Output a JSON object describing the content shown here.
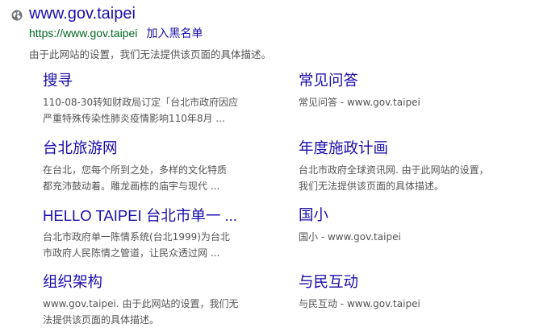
{
  "result": {
    "globe_icon": "globe-icon",
    "title": "www.gov.taipei",
    "url": "https://www.gov.taipei",
    "block_label": "加入黑名单",
    "snippet": "由于此网站的设置，我们无法提供该页面的具体描述。"
  },
  "sitelinks": [
    {
      "title": "搜寻",
      "snippet_line1": "110-08-30转知财政局订定「台北市政府因应",
      "snippet_line2": "严重特殊传染性肺炎疫情影响110年8月 ..."
    },
    {
      "title": "常见问答",
      "snippet_line1": "常见问答 - www.gov.taipei",
      "snippet_line2": ""
    },
    {
      "title": "台北旅游网",
      "snippet_line1": "在台北，您每个所到之处，多样的文化特质",
      "snippet_line2": "都充沛鼓动着。雕龙画栋的庙宇与现代 ..."
    },
    {
      "title": "年度施政计画",
      "snippet_line1": "台北市政府全球资讯网. 由于此网站的设置，",
      "snippet_line2": "我们无法提供该页面的具体描述。"
    },
    {
      "title": "HELLO TAIPEI 台北市单一 ...",
      "snippet_line1": "台北市政府单一陈情系统(台北1999)为台北",
      "snippet_line2": "市政府人民陈情之管道，让民众透过网 ..."
    },
    {
      "title": "国小",
      "snippet_line1": "国小 - www.gov.taipei",
      "snippet_line2": ""
    },
    {
      "title": "组织架构",
      "snippet_line1": "www.gov.taipei. 由于此网站的设置，我们无",
      "snippet_line2": "法提供该页面的具体描述。"
    },
    {
      "title": "与民互动",
      "snippet_line1": "与民互动 - www.gov.taipei",
      "snippet_line2": ""
    }
  ],
  "colors": {
    "link": "#1a0dab",
    "url": "#006621",
    "snippet": "#545454",
    "icon": "#70757a"
  }
}
